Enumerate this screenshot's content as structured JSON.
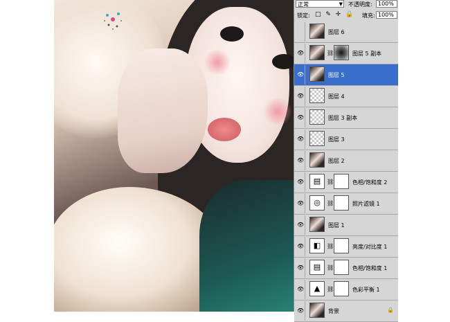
{
  "panel": {
    "blend_mode": "正常",
    "opacity_label": "不透明度:",
    "opacity_value": "100%",
    "lock_label": "锁定:",
    "lock_icons": "□ ✎ ✛ 🔒",
    "fill_label": "填充:",
    "fill_value": "100%"
  },
  "layers": [
    {
      "name": "图层 6",
      "visible": false,
      "thumb": "photo",
      "mask": "none",
      "selected": false
    },
    {
      "name": "图层 5 副本",
      "visible": true,
      "thumb": "photo",
      "mask": "radial",
      "selected": false
    },
    {
      "name": "图层 5",
      "visible": true,
      "thumb": "photo",
      "mask": "none",
      "selected": true
    },
    {
      "name": "图层 4",
      "visible": true,
      "thumb": "empty",
      "mask": "none",
      "selected": false
    },
    {
      "name": "图层 3 副本",
      "visible": true,
      "thumb": "empty",
      "mask": "none",
      "selected": false
    },
    {
      "name": "图层 3",
      "visible": true,
      "thumb": "empty",
      "mask": "none",
      "selected": false
    },
    {
      "name": "图层 2",
      "visible": true,
      "thumb": "photo",
      "mask": "none",
      "selected": false
    },
    {
      "name": "色相/饱和度 2",
      "visible": true,
      "thumb": "adjust",
      "glyph": "▤",
      "mask": "white",
      "selected": false
    },
    {
      "name": "照片滤镜 1",
      "visible": true,
      "thumb": "adjust",
      "glyph": "◎",
      "mask": "white",
      "selected": false
    },
    {
      "name": "图层 1",
      "visible": true,
      "thumb": "photo",
      "mask": "none",
      "selected": false
    },
    {
      "name": "亮度/对比度 1",
      "visible": true,
      "thumb": "adjust",
      "glyph": "◧",
      "mask": "white",
      "selected": false
    },
    {
      "name": "色相/饱和度 1",
      "visible": true,
      "thumb": "adjust",
      "glyph": "▤",
      "mask": "white",
      "selected": false
    },
    {
      "name": "色彩平衡 1",
      "visible": true,
      "thumb": "adjust",
      "glyph": "▲",
      "mask": "white",
      "selected": false
    },
    {
      "name": "背景",
      "visible": true,
      "thumb": "photo",
      "mask": "none",
      "selected": false,
      "locked": true
    }
  ],
  "colors": {
    "selected": "#3a6ecc",
    "panel": "#d6d6d6"
  }
}
